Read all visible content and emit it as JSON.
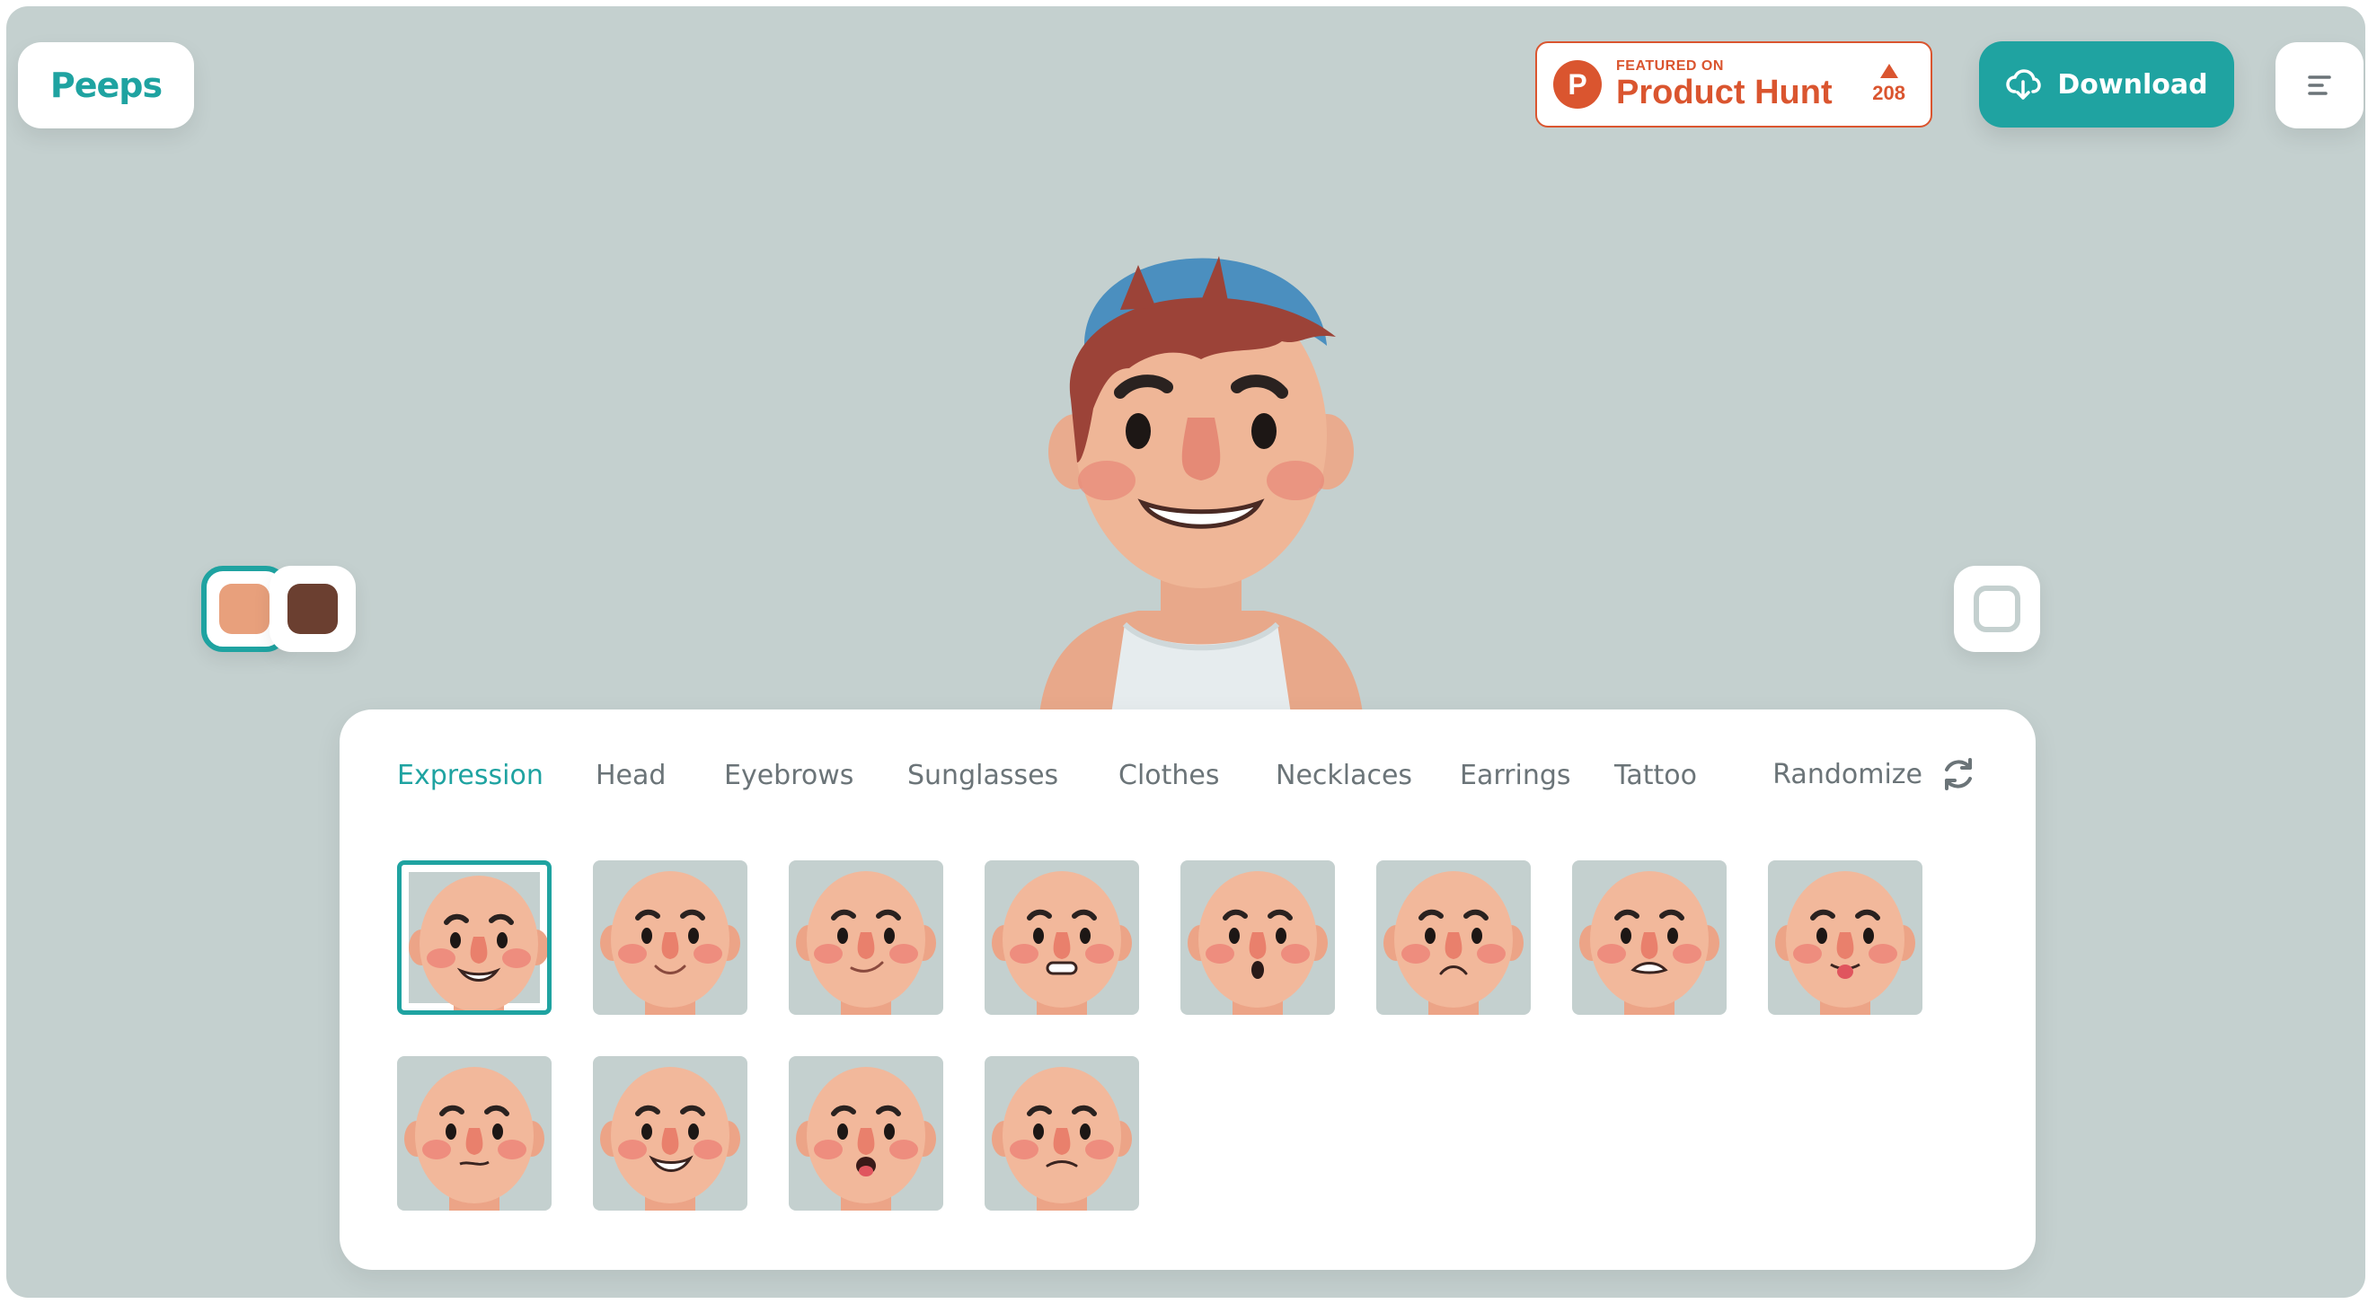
{
  "app": {
    "logo_text": "Peeps"
  },
  "header": {
    "product_hunt": {
      "featured_label": "FEATURED ON",
      "name": "Product Hunt",
      "votes": "208",
      "brand_color": "#da552f"
    },
    "download_label": "Download",
    "download_icon": "cloud-download-icon",
    "menu_icon": "menu-icon"
  },
  "colors": {
    "accent": "#1fa3a1",
    "background": "#c4d0cf",
    "panel": "#ffffff",
    "text_muted": "#6b7478"
  },
  "skin_tones": [
    {
      "name": "light",
      "color": "#e8a07c",
      "selected": true
    },
    {
      "name": "dark",
      "color": "#6b3f30",
      "selected": false
    }
  ],
  "tabs": [
    {
      "label": "Expression",
      "active": true
    },
    {
      "label": "Head",
      "active": false
    },
    {
      "label": "Eyebrows",
      "active": false
    },
    {
      "label": "Sunglasses",
      "active": false
    },
    {
      "label": "Clothes",
      "active": false
    },
    {
      "label": "Necklaces",
      "active": false
    },
    {
      "label": "Earrings",
      "active": false
    },
    {
      "label": "Tattoo",
      "active": false
    }
  ],
  "randomize": {
    "label": "Randomize",
    "icon": "refresh-icon"
  },
  "expressions": [
    {
      "mouth": "grin",
      "selected": true
    },
    {
      "mouth": "smile",
      "selected": false
    },
    {
      "mouth": "smirk",
      "selected": false
    },
    {
      "mouth": "grimace",
      "selected": false
    },
    {
      "mouth": "surprised",
      "selected": false
    },
    {
      "mouth": "frown",
      "selected": false
    },
    {
      "mouth": "clenched",
      "selected": false
    },
    {
      "mouth": "tongue",
      "selected": false
    },
    {
      "mouth": "nervous",
      "selected": false
    },
    {
      "mouth": "big-grin",
      "selected": false
    },
    {
      "mouth": "tongue-open",
      "selected": false
    },
    {
      "mouth": "flat",
      "selected": false
    }
  ]
}
